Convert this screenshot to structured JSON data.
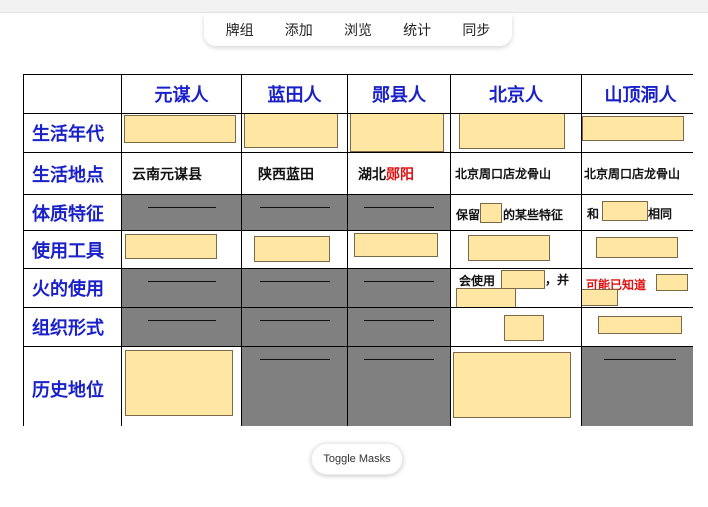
{
  "menu": {
    "items": [
      "牌组",
      "添加",
      "浏览",
      "统计",
      "同步"
    ]
  },
  "table": {
    "headers": [
      "",
      "元谋人",
      "蓝田人",
      "郧县人",
      "北京人",
      "山顶洞人"
    ],
    "row_labels": [
      "生活年代",
      "生活地点",
      "体质特征",
      "使用工具",
      "火的使用",
      "组织形式",
      "历史地位"
    ],
    "place": {
      "yuanmou": "云南元谋县",
      "lantian": "陕西蓝田",
      "yunxian_prefix": "湖北",
      "yunxian_red": "郧阳",
      "beijing": "北京周口店龙骨山",
      "shandingdong": "北京周口店龙骨山"
    },
    "beijing_trait": {
      "pre": "保留",
      "post": "的某些特征"
    },
    "shandingdong_trait": {
      "pre": "和",
      "post": "相同"
    },
    "beijing_fire": {
      "pre": "会使用",
      "post": "，并"
    },
    "shandingdong_fire": "可能已知道"
  },
  "colors": {
    "header_text": "#1a21c8",
    "mask_fill": "#ffe7a3",
    "gray_cell": "#808080",
    "highlight_red": "#e01010"
  },
  "toggle_label": "Toggle Masks"
}
